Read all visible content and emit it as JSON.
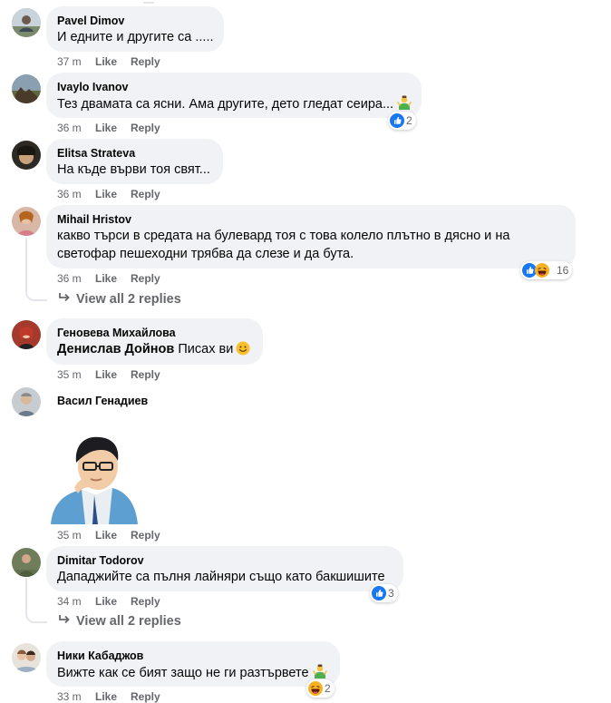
{
  "comments": [
    {
      "name": "Pavel Dimov",
      "text": "И едните и другите са .....",
      "time": "37 m",
      "like": "Like",
      "reply": "Reply"
    },
    {
      "name": "Ivaylo Ivanov",
      "text": "Тез двамата са ясни. Ама другите, дето гледат сеира...",
      "time": "36 m",
      "like": "Like",
      "reply": "Reply",
      "reactions": "2"
    },
    {
      "name": "Elitsa Strateva",
      "text": "На къде върви тоя свят...",
      "time": "36 m",
      "like": "Like",
      "reply": "Reply"
    },
    {
      "name": "Mihail Hristov",
      "text1": "какво търси в средата на булевард тоя с това колело плътно в дясно и на",
      "text2": "светофар пешеходни трябва да слезе и да бута.",
      "time": "36 m",
      "like": "Like",
      "reply": "Reply",
      "reactions": "16",
      "view_all": "View all 2 replies"
    },
    {
      "name": "Геновева Михайлова",
      "mention": "Денислав Дойнов",
      "text": "Писах ви",
      "time": "35 m",
      "like": "Like",
      "reply": "Reply"
    },
    {
      "name": "Васил Генадиев",
      "time": "35 m",
      "like": "Like",
      "reply": "Reply"
    },
    {
      "name": "Dimitar Todorov",
      "text": "Дападжийте са пълня лайняри също като бакшишите",
      "time": "34 m",
      "like": "Like",
      "reply": "Reply",
      "reactions": "3",
      "view_all": "View all 2 replies"
    },
    {
      "name": "Ники Кабаджов",
      "text": "Вижте как се бият защо не ги разтървете",
      "time": "33 m",
      "like": "Like",
      "reply": "Reply",
      "reactions": "2"
    }
  ],
  "icons": {
    "like": "thumbs-up-icon",
    "haha": "laughing-face-icon",
    "shrug": "person-shrugging-icon",
    "smile": "smiling-face-icon",
    "arrow": "reply-arrow-icon"
  },
  "colors": {
    "like": "#1877f2",
    "haha": "#f7b125",
    "bubble": "#f0f2f5",
    "meta": "#65676b"
  }
}
